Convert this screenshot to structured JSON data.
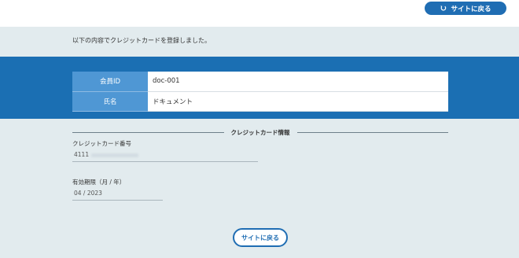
{
  "header": {
    "back_button_label": "サイトに戻る",
    "back_icon": "return-arrow-icon"
  },
  "confirmation": {
    "message": "以下の内容でクレジットカードを登録しました。"
  },
  "member_table": {
    "rows": [
      {
        "label": "会員ID",
        "value": "doc-001"
      },
      {
        "label": "氏名",
        "value": "ドキュメント"
      }
    ]
  },
  "credit_card_section": {
    "title": "クレジットカード情報",
    "card_number_label": "クレジットカード番号",
    "card_number_value": "4111",
    "expiry_label": "有効期限（月 / 年）",
    "expiry_value": "04 / 2023"
  },
  "footer": {
    "back_button_label": "サイトに戻る"
  },
  "colors": {
    "primary_blue": "#1b6fb3",
    "table_header_blue": "#4f97d4",
    "page_background": "#e2ebee"
  }
}
